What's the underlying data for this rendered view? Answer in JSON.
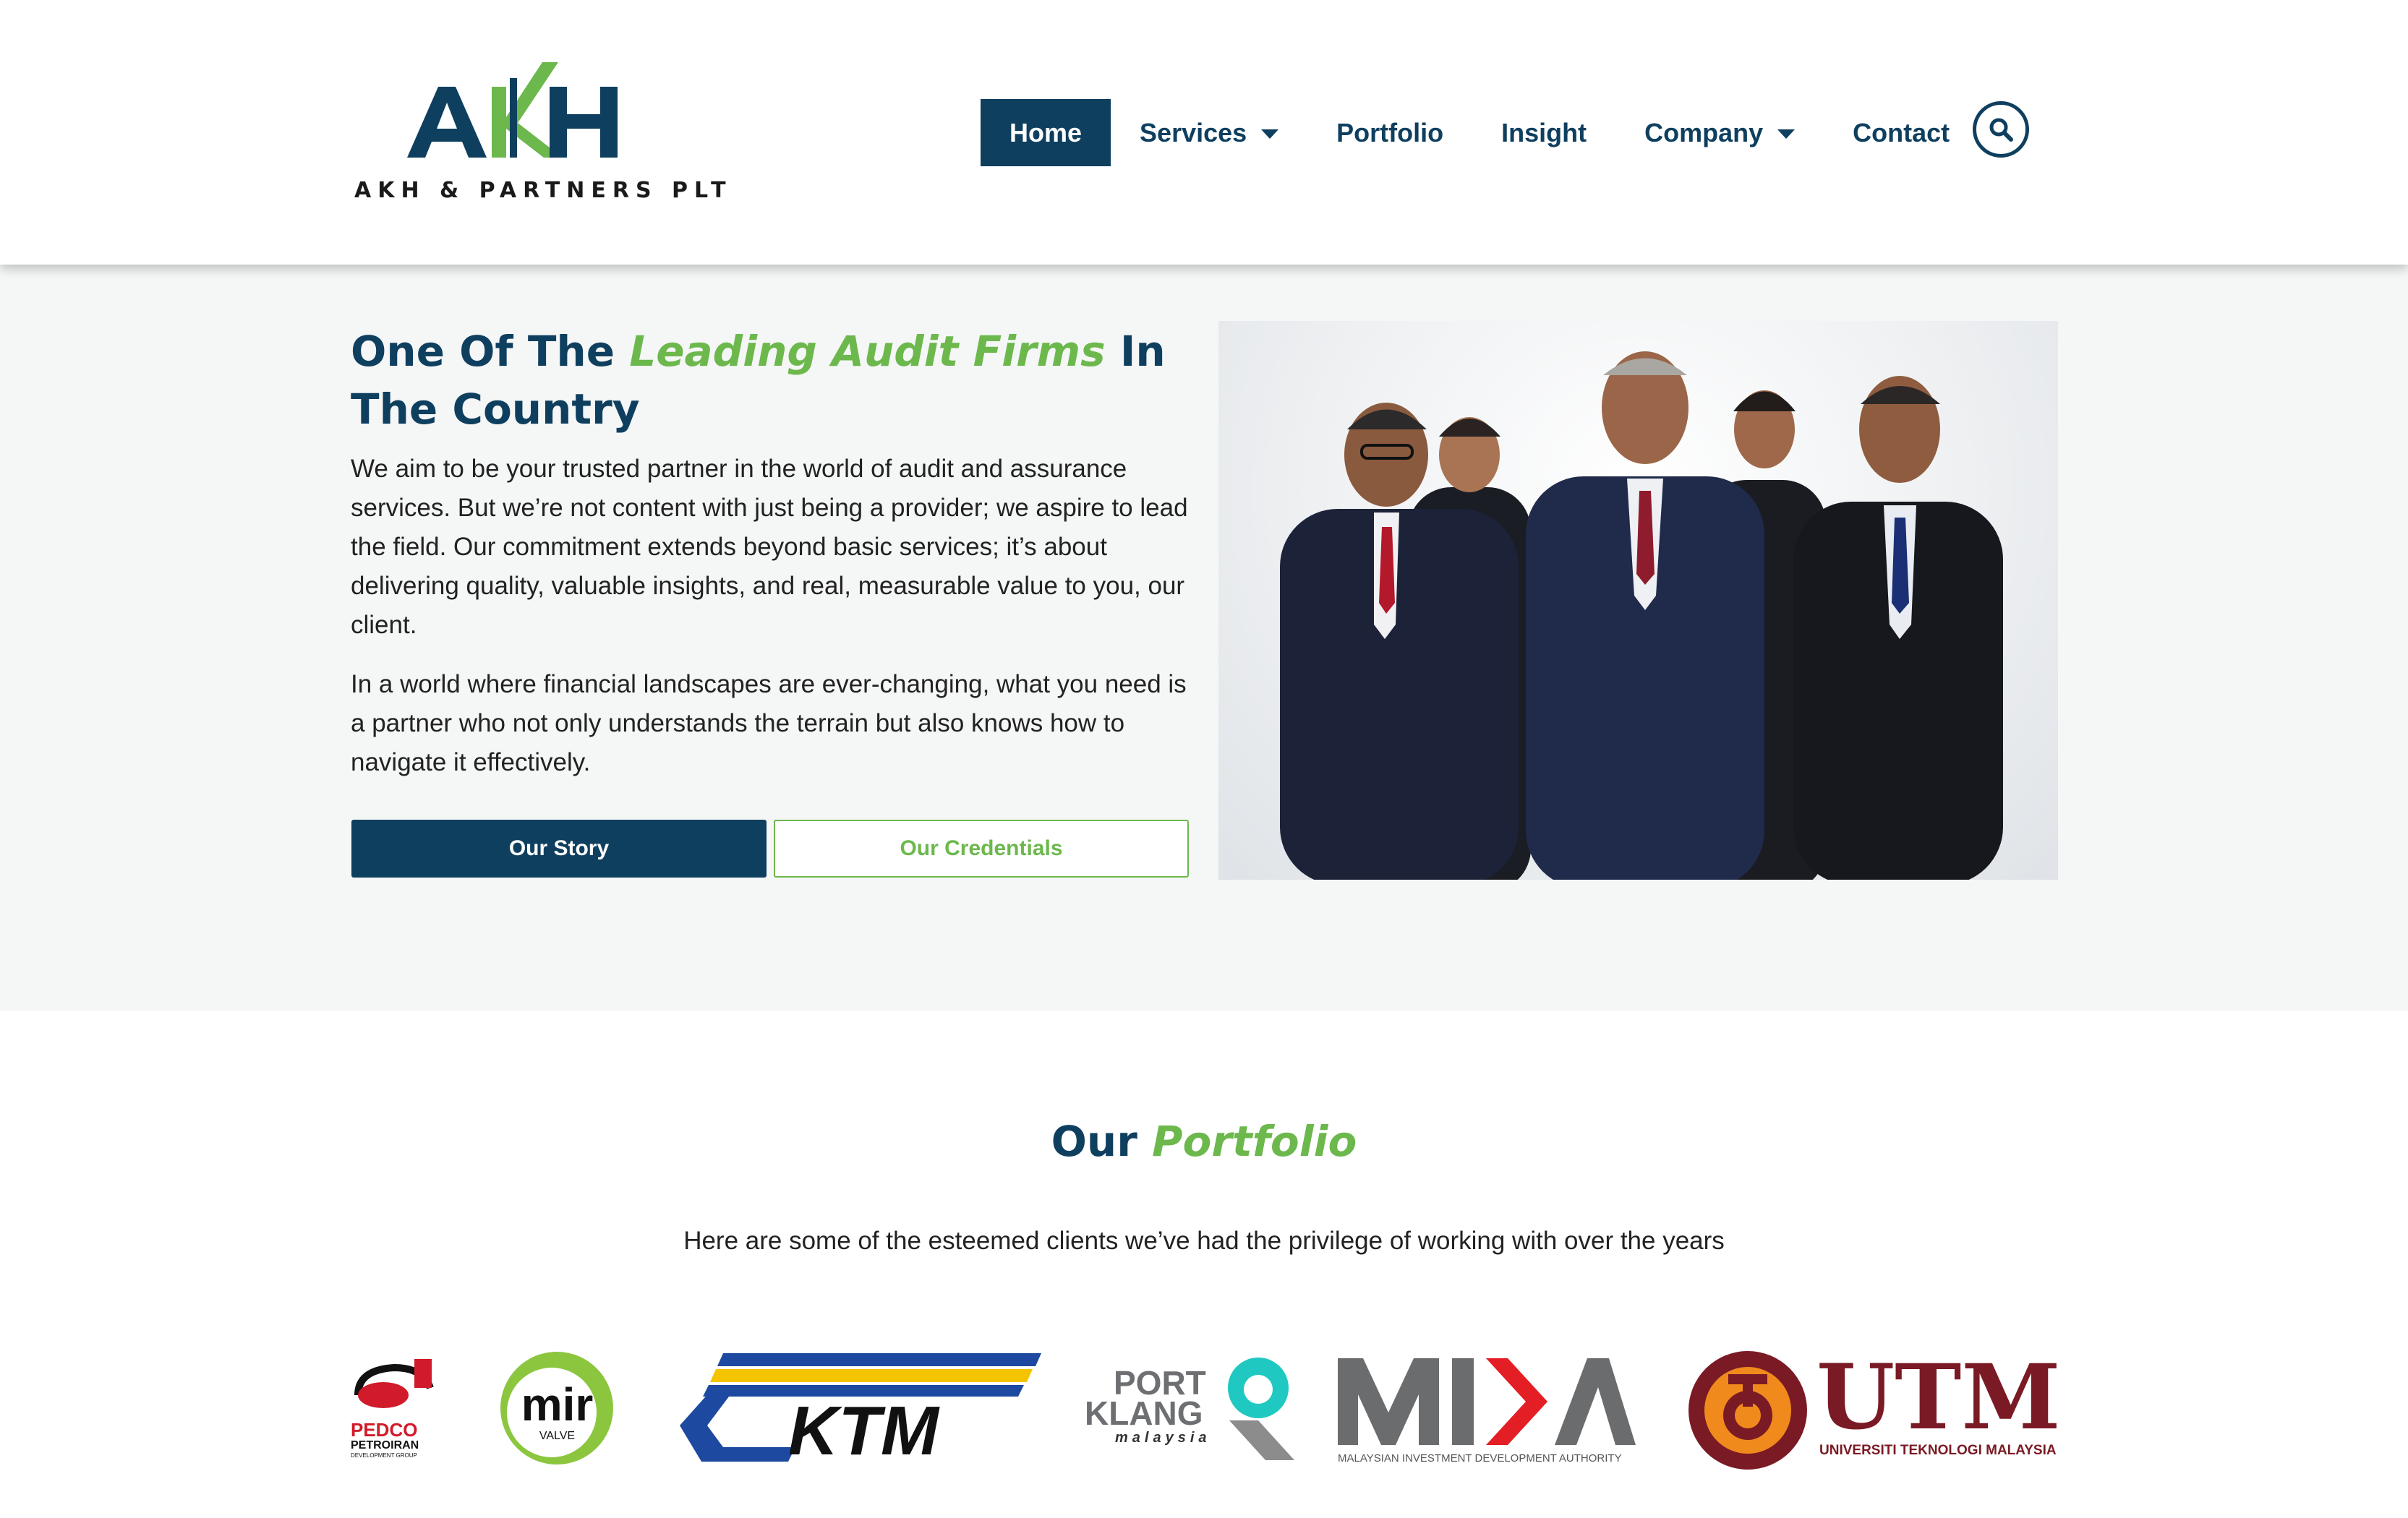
{
  "brand": {
    "logo_letters": "AKH",
    "tagline": "AKH & PARTNERS PLT",
    "primary_color": "#0f3f5f",
    "accent_color": "#6cb84d"
  },
  "nav": {
    "items": [
      {
        "label": "Home",
        "active": true,
        "dropdown": false
      },
      {
        "label": "Services",
        "active": false,
        "dropdown": true
      },
      {
        "label": "Portfolio",
        "active": false,
        "dropdown": false
      },
      {
        "label": "Insight",
        "active": false,
        "dropdown": false
      },
      {
        "label": "Company",
        "active": false,
        "dropdown": true
      },
      {
        "label": "Contact",
        "active": false,
        "dropdown": false
      }
    ],
    "search_icon": "search-icon"
  },
  "hero": {
    "title_part1": "One Of The ",
    "title_accent": "Leading Audit Firms",
    "title_part2": " In The Country",
    "paragraph1": "We aim to be your trusted partner in the world of audit and assurance services. But we’re not content with just being a provider; we aspire to lead the field. Our commitment extends beyond basic services; it’s about delivering quality, valuable insights, and real, measurable value to you, our client.",
    "paragraph2": "In a world where financial landscapes are ever-changing, what you need is a partner who not only understands the terrain but also knows how to navigate it effectively.",
    "btn_story": "Our Story",
    "btn_credentials": "Our Credentials"
  },
  "portfolio": {
    "title_part1": "Our ",
    "title_accent": "Portfolio",
    "subtitle": "Here are some of the esteemed clients we’ve had the privilege of working with over the years",
    "clients": [
      {
        "name": "PEDCO",
        "sub1": "PETROIRAN",
        "sub2": "DEVELOPMENT GROUP"
      },
      {
        "name": "mir",
        "sub1": "VALVE"
      },
      {
        "name": "KTM"
      },
      {
        "name": "PORT",
        "sub1": "KLANG",
        "sub2": "malaysia"
      },
      {
        "name": "MIDA",
        "sub1": "MALAYSIAN INVESTMENT DEVELOPMENT AUTHORITY"
      },
      {
        "name": "UTM",
        "sub1": "UNIVERSITI TEKNOLOGI MALAYSIA"
      }
    ]
  }
}
